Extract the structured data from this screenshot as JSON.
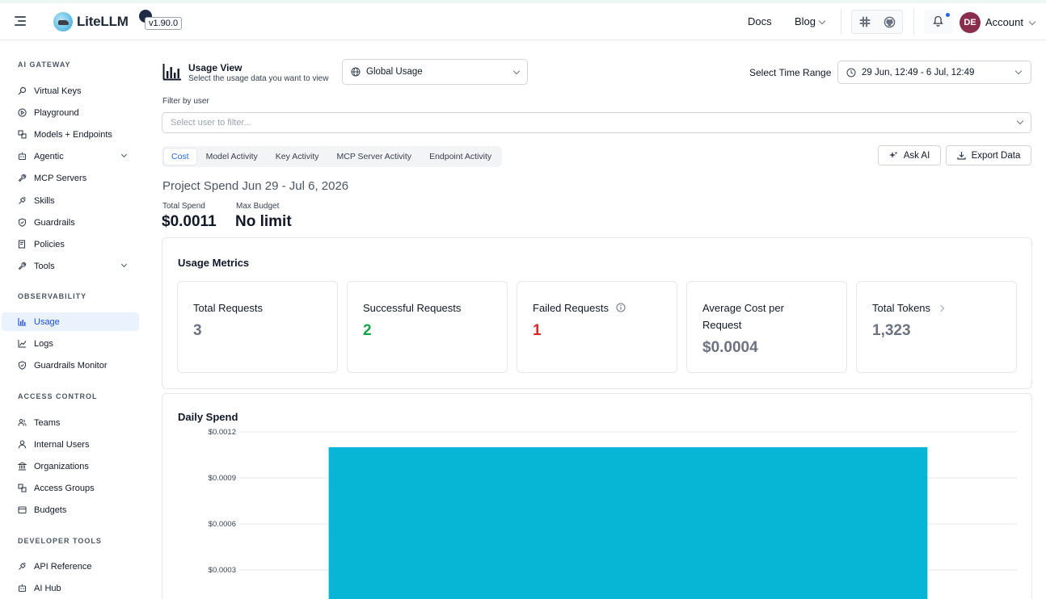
{
  "header": {
    "brand": "LiteLLM",
    "version": "v1.90.0",
    "links": {
      "docs": "Docs",
      "blog": "Blog"
    },
    "avatar_initials": "DE",
    "account_label": "Account"
  },
  "sidebar": {
    "sections": [
      {
        "title": "AI GATEWAY",
        "items": [
          {
            "label": "Virtual Keys",
            "icon": "key-icon"
          },
          {
            "label": "Playground",
            "icon": "play-circle-icon"
          },
          {
            "label": "Models + Endpoints",
            "icon": "blocks-icon"
          },
          {
            "label": "Agentic",
            "icon": "robot-icon",
            "expandable": true
          },
          {
            "label": "MCP Servers",
            "icon": "tool-icon"
          },
          {
            "label": "Skills",
            "icon": "plug-icon"
          },
          {
            "label": "Guardrails",
            "icon": "shield-icon"
          },
          {
            "label": "Policies",
            "icon": "document-check-icon"
          },
          {
            "label": "Tools",
            "icon": "wrench-icon",
            "expandable": true
          }
        ]
      },
      {
        "title": "OBSERVABILITY",
        "items": [
          {
            "label": "Usage",
            "icon": "bar-chart-icon",
            "active": true
          },
          {
            "label": "Logs",
            "icon": "line-chart-icon"
          },
          {
            "label": "Guardrails Monitor",
            "icon": "shield-icon"
          }
        ]
      },
      {
        "title": "ACCESS CONTROL",
        "items": [
          {
            "label": "Teams",
            "icon": "team-icon"
          },
          {
            "label": "Internal Users",
            "icon": "user-icon"
          },
          {
            "label": "Organizations",
            "icon": "bank-icon"
          },
          {
            "label": "Access Groups",
            "icon": "blocks-icon"
          },
          {
            "label": "Budgets",
            "icon": "wallet-icon"
          }
        ]
      },
      {
        "title": "DEVELOPER TOOLS",
        "items": [
          {
            "label": "API Reference",
            "icon": "plug-icon"
          },
          {
            "label": "AI Hub",
            "icon": "robot-icon"
          }
        ]
      }
    ]
  },
  "usage_view": {
    "title": "Usage View",
    "subtitle": "Select the usage data you want to view",
    "selected": "Global Usage",
    "time_range_label": "Select Time Range",
    "time_range_value": "29 Jun, 12:49 - 6 Jul, 12:49",
    "filter_label": "Filter by user",
    "filter_placeholder": "Select user to filter..."
  },
  "tabs": [
    "Cost",
    "Model Activity",
    "Key Activity",
    "MCP Server Activity",
    "Endpoint Activity"
  ],
  "actions": {
    "ask_ai": "Ask AI",
    "export": "Export Data"
  },
  "project": {
    "title": "Project Spend Jun 29 - Jul 6, 2026",
    "total_spend_label": "Total Spend",
    "total_spend": "$0.0011",
    "max_budget_label": "Max Budget",
    "max_budget": "No limit"
  },
  "metrics": {
    "title": "Usage Metrics",
    "cards": [
      {
        "label": "Total Requests",
        "value": "3",
        "color": "#6b7280"
      },
      {
        "label": "Successful Requests",
        "value": "2",
        "color": "#16a34a"
      },
      {
        "label": "Failed Requests",
        "value": "1",
        "color": "#dc2626"
      },
      {
        "label": "Average Cost per Request",
        "value": "$0.0004",
        "color": "#6b7280"
      },
      {
        "label": "Total Tokens",
        "value": "1,323",
        "color": "#6b7280"
      }
    ]
  },
  "daily_spend": {
    "title": "Daily Spend",
    "chart_data": {
      "type": "bar",
      "categories": [
        ""
      ],
      "values": [
        0.0011
      ],
      "ylim": [
        0,
        0.0012
      ],
      "yticks": [
        "$0.0012",
        "$0.0009",
        "$0.0006",
        "$0.0003"
      ],
      "ytick_values": [
        0.0012,
        0.0009,
        0.0006,
        0.0003
      ],
      "bar_color": "#06b6d4",
      "grid": true
    }
  },
  "colors": {
    "accent": "#2563eb",
    "active_bg": "#eaf2fd",
    "bar": "#06b6d4"
  }
}
